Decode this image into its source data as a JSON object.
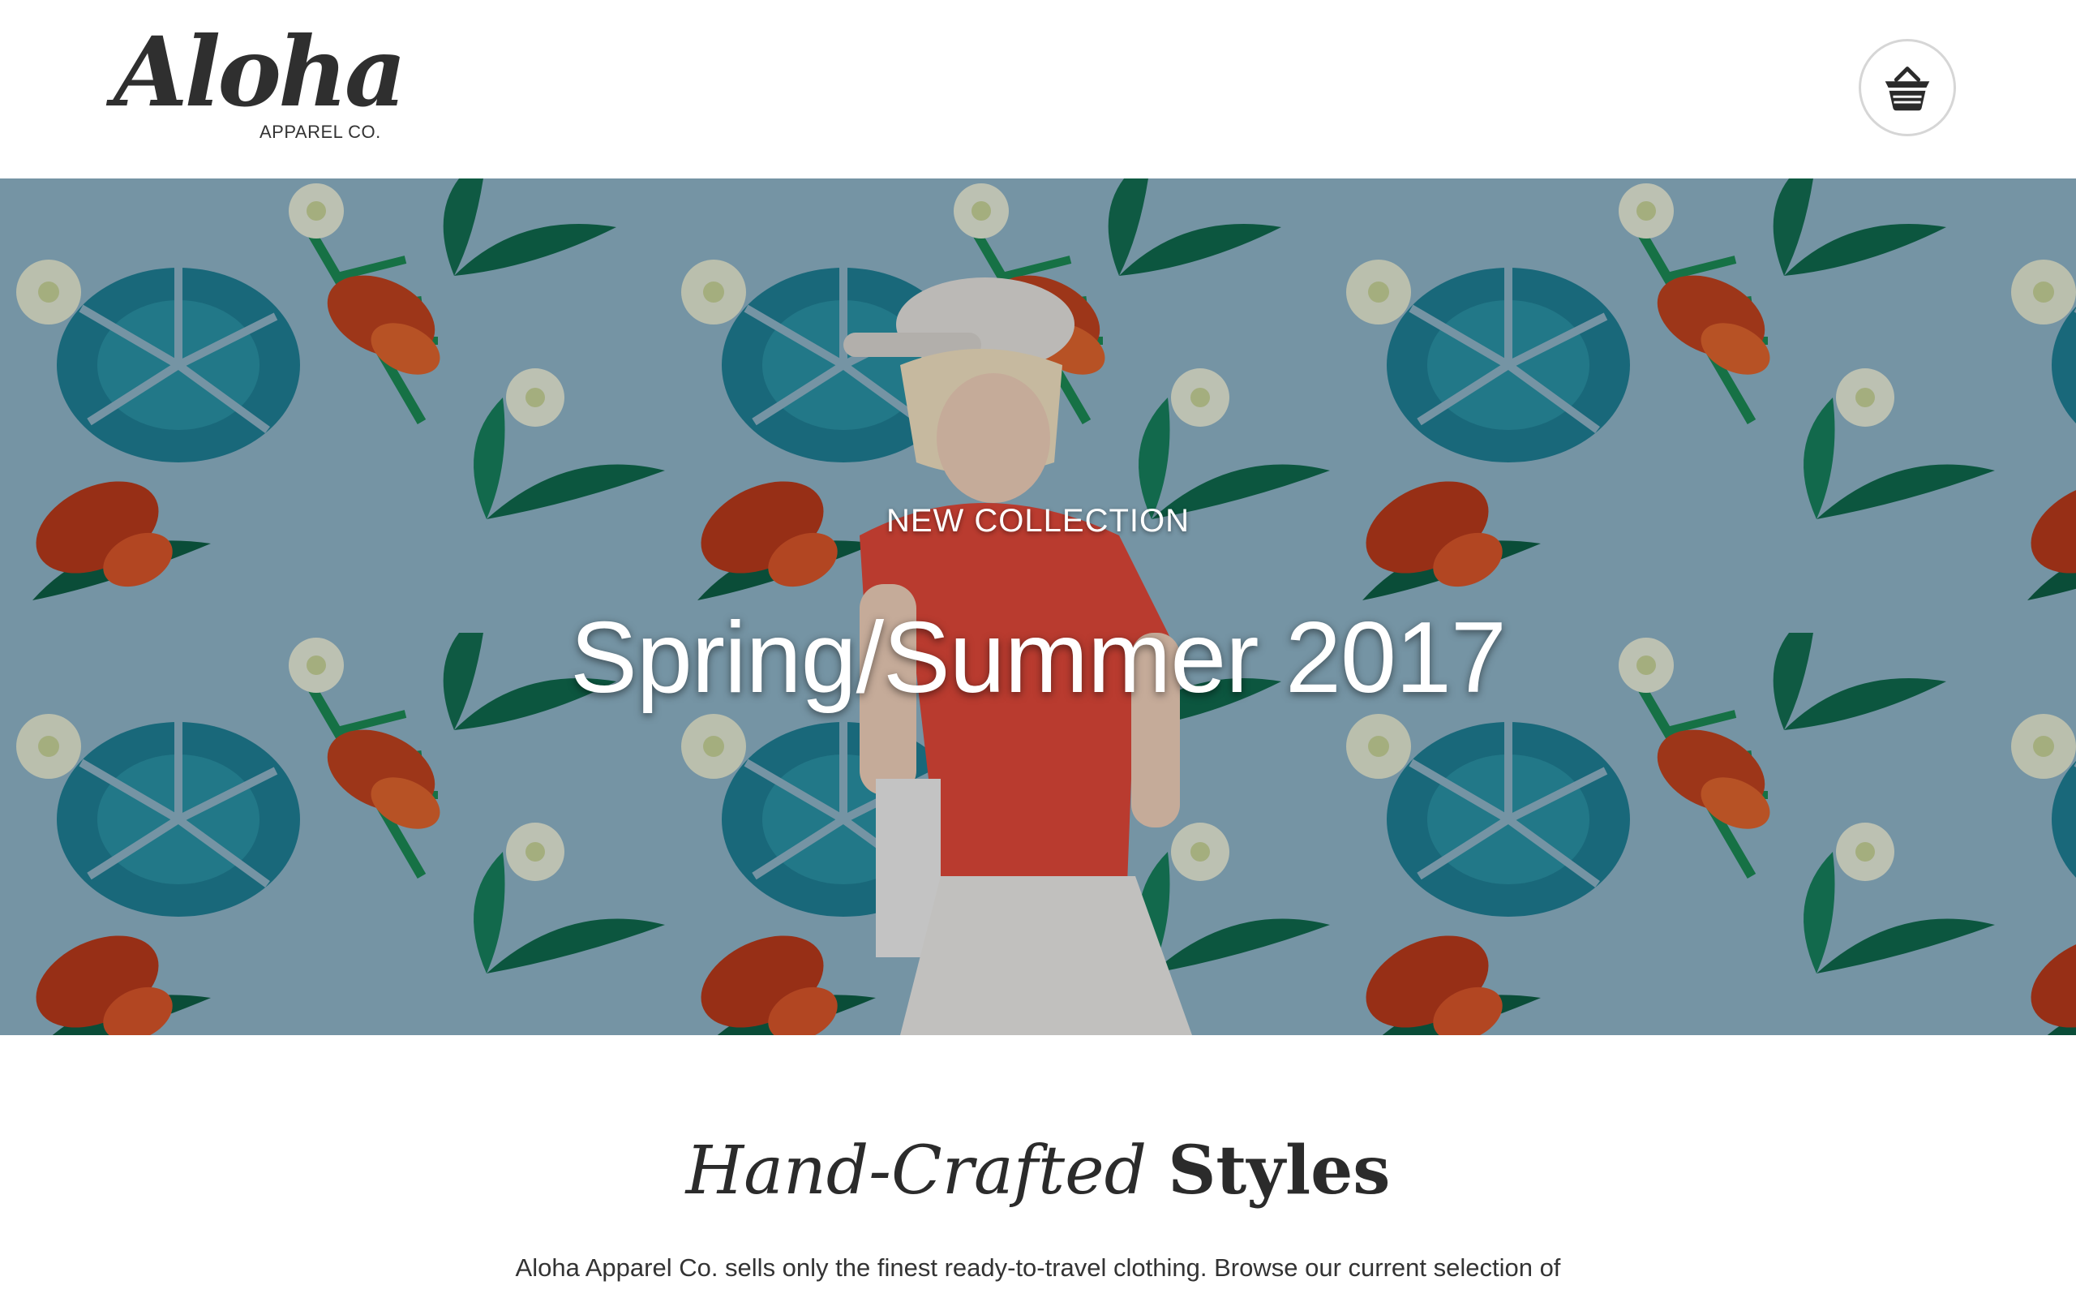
{
  "header": {
    "logo_script": "Aloha",
    "logo_subtitle": "APPAREL CO.",
    "cart_icon": "shopping-basket-icon"
  },
  "hero": {
    "eyebrow": "NEW COLLECTION",
    "title": "Spring/Summer 2017",
    "background": "tropical-pattern-with-model-photo"
  },
  "intro": {
    "heading_italic": "Hand-Crafted",
    "heading_bold": "Styles",
    "text": "Aloha Apparel Co. sells only the finest ready-to-travel clothing. Browse our current selection of"
  },
  "colors": {
    "hero_sky": "#8fb5c9",
    "shirt": "#e2483a",
    "leaf_dark": "#0f6a4d",
    "leaf_teal": "#1f7f95",
    "flower": "#c0421f"
  }
}
